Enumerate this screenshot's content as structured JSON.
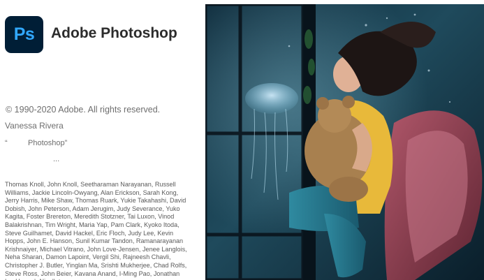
{
  "app": {
    "logo_text": "Ps",
    "title": "Adobe Photoshop"
  },
  "info": {
    "copyright": "© 1990-2020 Adobe. All rights reserved.",
    "user_name": "Vanessa Rivera",
    "quote_open": "“",
    "product_name": "Photoshop”",
    "ellipsis": "..."
  },
  "credits": "Thomas Knoll, John Knoll, Seetharaman Narayanan, Russell Williams, Jackie Lincoln-Owyang, Alan Erickson, Sarah Kong, Jerry Harris, Mike Shaw, Thomas Ruark, Yukie Takahashi, David Dobish, John Peterson, Adam Jerugim, Judy Severance, Yuko Kagita, Foster Brereton, Meredith Stotzner, Tai Luxon, Vinod Balakrishnan, Tim Wright, Maria Yap, Pam Clark, Kyoko Itoda, Steve Guilhamet, David Hackel, Eric Floch, Judy Lee, Kevin Hopps, John E. Hanson, Sunil Kumar Tandon, Ramanarayanan Krishnaiyer, Michael Vitrano, John Love-Jensen, Jenee Langlois, Neha Sharan, Damon Lapoint, Vergil Shi, Rajneesh Chavli, Christopher J. Butler, Yinglan Ma, Srishti Mukherjee, Chad Rolfs, Steve Ross, John Beier, Kavana Anand, I-Ming Pao, Jonathan Lo, Hannah Nicollet,",
  "colors": {
    "logo_bg": "#001e36",
    "logo_fg": "#31a8ff",
    "title": "#2c2c2c",
    "text_muted": "#6e6e6e"
  }
}
